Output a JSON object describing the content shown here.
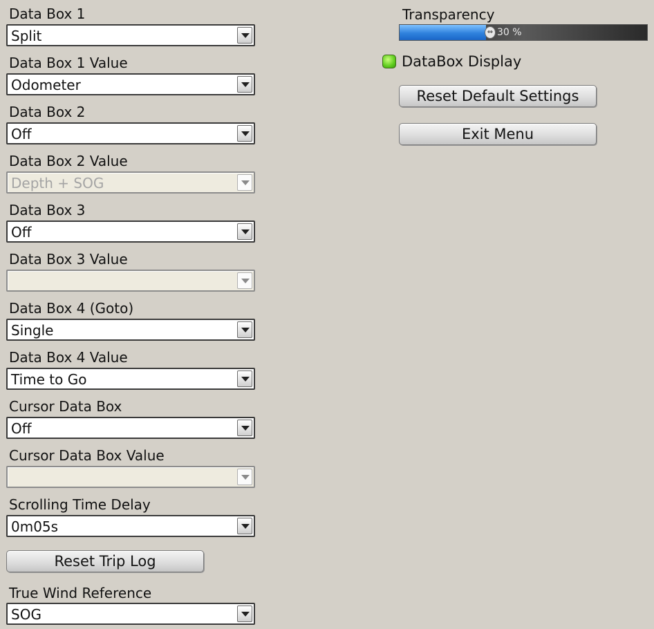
{
  "fields": [
    {
      "label": "Data Box 1",
      "value": "Split",
      "enabled": true
    },
    {
      "label": "Data Box 1 Value",
      "value": "Odometer",
      "enabled": true
    },
    {
      "label": "Data Box 2",
      "value": "Off",
      "enabled": true
    },
    {
      "label": "Data Box 2 Value",
      "value": "Depth + SOG",
      "enabled": false
    },
    {
      "label": "Data Box 3",
      "value": "Off",
      "enabled": true
    },
    {
      "label": "Data Box 3 Value",
      "value": "",
      "enabled": false
    },
    {
      "label": "Data Box 4 (Goto)",
      "value": "Single",
      "enabled": true
    },
    {
      "label": "Data Box 4 Value",
      "value": "Time to Go",
      "enabled": true
    },
    {
      "label": "Cursor Data Box",
      "value": "Off",
      "enabled": true
    },
    {
      "label": "Cursor Data Box Value",
      "value": "",
      "enabled": false
    },
    {
      "label": "Scrolling Time Delay",
      "value": "0m05s",
      "enabled": true
    }
  ],
  "reset_trip_log_label": "Reset Trip Log",
  "true_wind": {
    "label": "True Wind Reference",
    "value": "SOG",
    "enabled": true
  },
  "transparency": {
    "label": "Transparency",
    "value_percent": 30,
    "value_text": "30 %"
  },
  "databox_display": {
    "label": "DataBox Display",
    "checked": true,
    "indicator_color": "#5fcc1e"
  },
  "reset_default_label": "Reset Default Settings",
  "exit_menu_label": "Exit Menu",
  "icons": {
    "dropdown_arrow": "chevron-down-icon",
    "slider_thumb": "slider-thumb-icon",
    "checkbox": "led-checkbox-icon"
  }
}
